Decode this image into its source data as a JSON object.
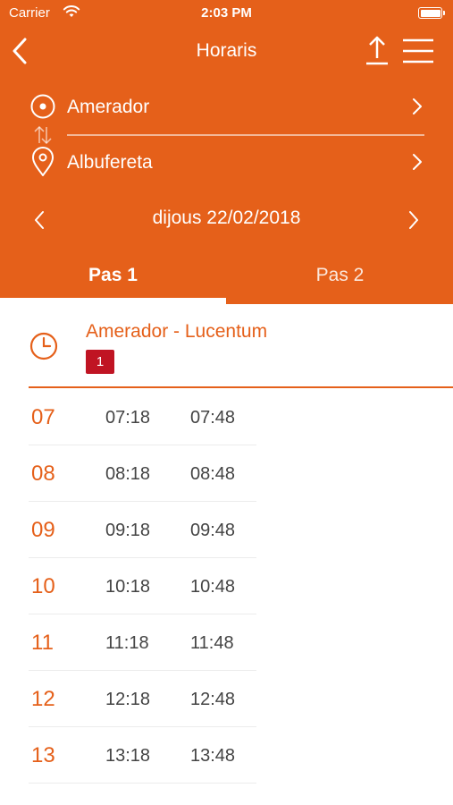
{
  "status_bar": {
    "carrier": "Carrier",
    "time": "2:03 PM"
  },
  "nav": {
    "title": "Horaris"
  },
  "route": {
    "origin": "Amerador",
    "destination": "Albufereta"
  },
  "date": {
    "label": "dijous 22/02/2018"
  },
  "tabs": [
    {
      "label": "Pas 1",
      "selected": true
    },
    {
      "label": "Pas 2",
      "selected": false
    }
  ],
  "line": {
    "name": "Amerador - Lucentum",
    "badge": "1",
    "badge_color": "#c01423"
  },
  "schedule": [
    {
      "hour": "07",
      "times": [
        "07:18",
        "07:48"
      ]
    },
    {
      "hour": "08",
      "times": [
        "08:18",
        "08:48"
      ]
    },
    {
      "hour": "09",
      "times": [
        "09:18",
        "09:48"
      ]
    },
    {
      "hour": "10",
      "times": [
        "10:18",
        "10:48"
      ]
    },
    {
      "hour": "11",
      "times": [
        "11:18",
        "11:48"
      ]
    },
    {
      "hour": "12",
      "times": [
        "12:18",
        "12:48"
      ]
    },
    {
      "hour": "13",
      "times": [
        "13:18",
        "13:48"
      ]
    }
  ],
  "colors": {
    "accent": "#e5601a",
    "badge": "#c01423",
    "text": "#444444"
  },
  "icons": [
    "wifi-icon",
    "battery-icon",
    "back-arrow-icon",
    "share-icon",
    "menu-icon",
    "origin-target-icon",
    "swap-icon",
    "location-pin-icon",
    "chevron-right-icon",
    "chevron-left-icon",
    "clock-icon"
  ]
}
